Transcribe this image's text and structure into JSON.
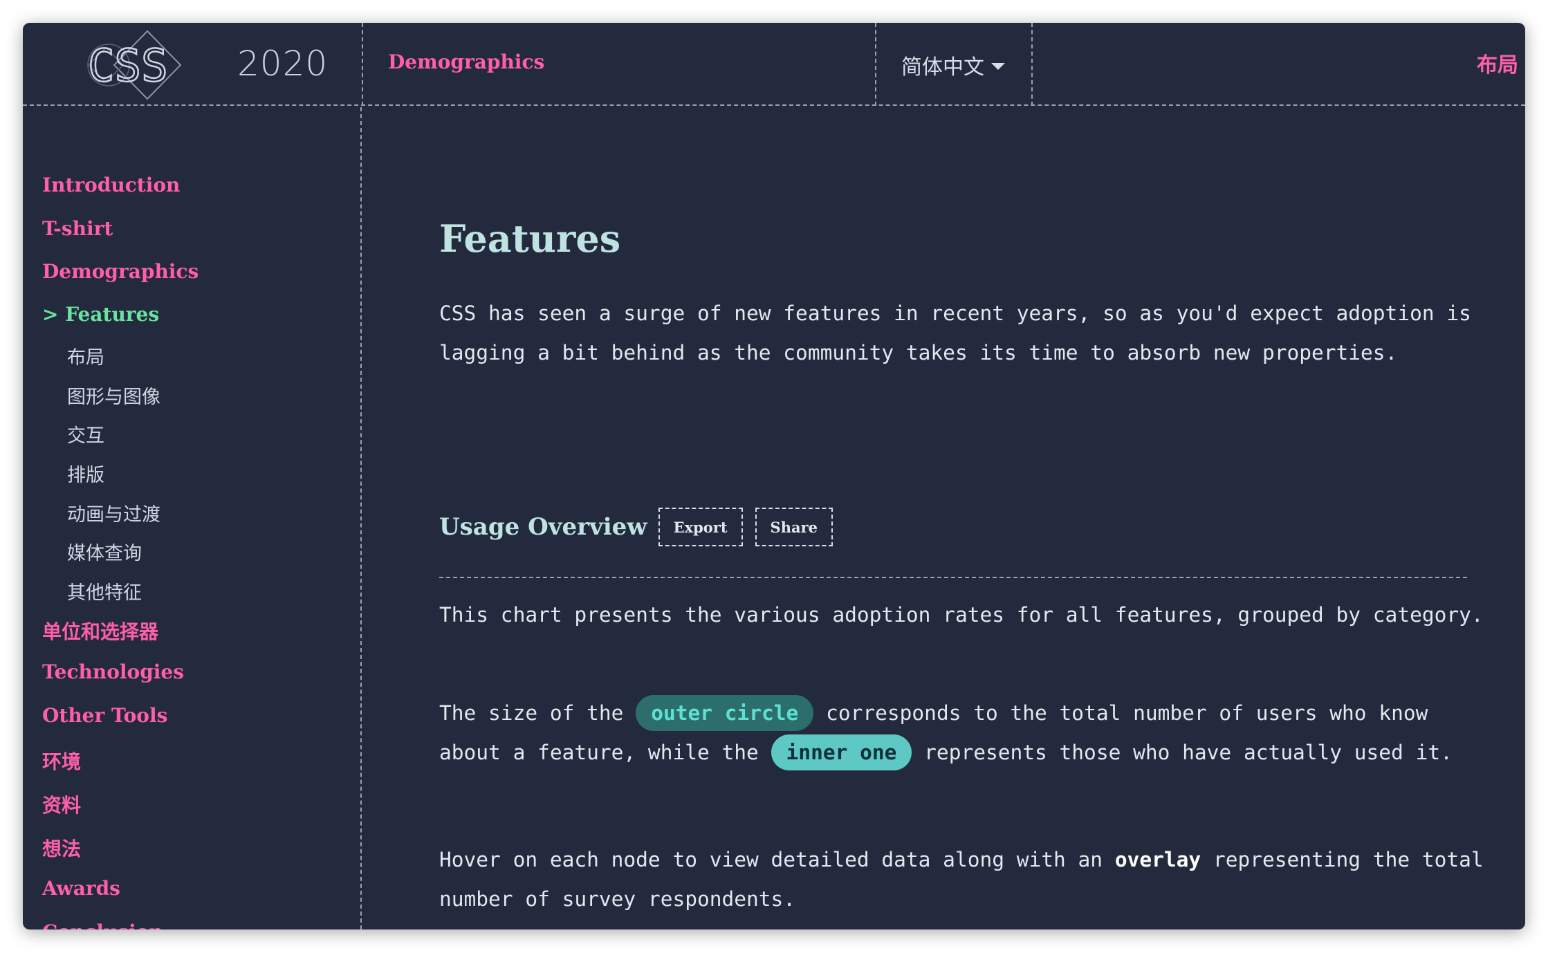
{
  "header": {
    "logo_text": "CSS",
    "logo_year": "2020",
    "section": "Demographics",
    "language": "简体中文",
    "right_link": "布局"
  },
  "sidebar": {
    "items": [
      {
        "label": "Introduction"
      },
      {
        "label": "T-shirt"
      },
      {
        "label": "Demographics"
      },
      {
        "label": "> Features",
        "active": true
      },
      {
        "label": "单位和选择器"
      },
      {
        "label": "Technologies"
      },
      {
        "label": "Other Tools"
      },
      {
        "label": "环境"
      },
      {
        "label": "资料"
      },
      {
        "label": "想法"
      },
      {
        "label": "Awards"
      },
      {
        "label": "Conclusion"
      }
    ],
    "subitems": [
      {
        "label": "布局"
      },
      {
        "label": "图形与图像"
      },
      {
        "label": "交互"
      },
      {
        "label": "排版"
      },
      {
        "label": "动画与过渡"
      },
      {
        "label": "媒体查询"
      },
      {
        "label": "其他特征"
      }
    ]
  },
  "main": {
    "title": "Features",
    "intro": "CSS has seen a surge of new features in recent years, so as you'd expect adoption is lagging a bit behind as the community takes its time to absorb new properties.",
    "usage_title": "Usage Overview",
    "export_label": "Export",
    "share_label": "Share",
    "chart_desc": "This chart presents the various adoption rates for all features, grouped by category.",
    "size_prefix": "The size of the",
    "outer_circle": "outer circle",
    "size_middle": "corresponds to the total number of users who know about a feature, while the",
    "inner_one": "inner one",
    "size_suffix": "represents those who have actually used it.",
    "hover_prefix": "Hover on each node to view detailed data along with an",
    "overlay": "overlay",
    "hover_suffix": "representing the total number of survey respondents."
  },
  "colors": {
    "background": "#242a3d",
    "accent_pink": "#fe5fa8",
    "active_green": "#69e3a0",
    "heading_teal": "#bfe3e0"
  }
}
